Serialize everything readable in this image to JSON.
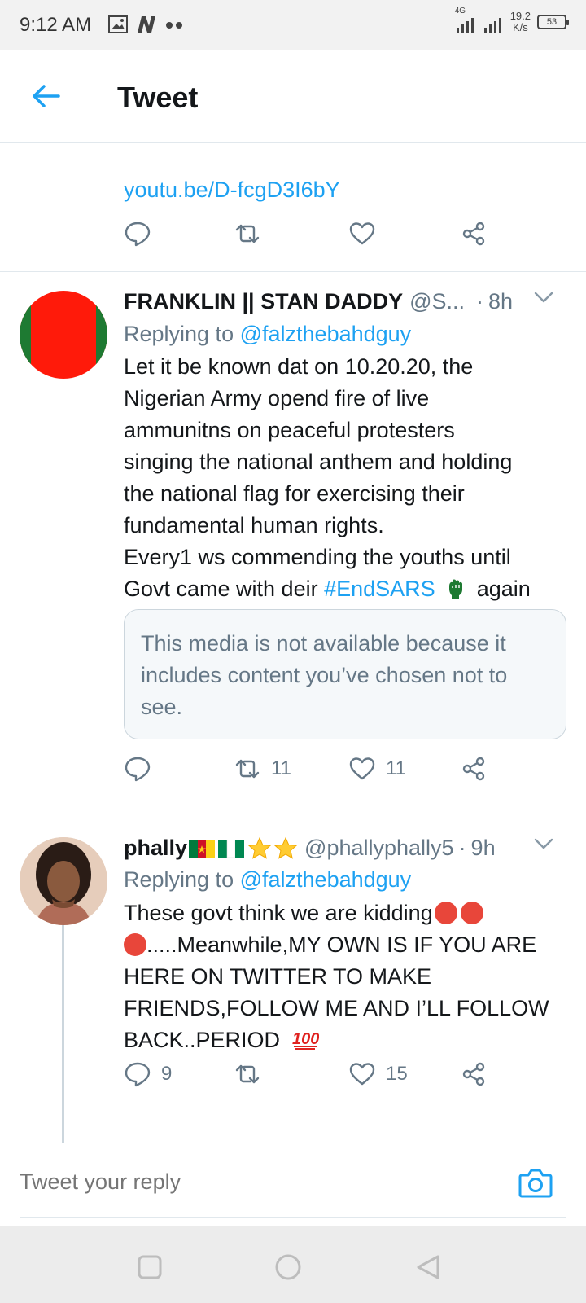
{
  "status_bar": {
    "time": "9:12 AM",
    "network_type": "4G",
    "net_speed_value": "19.2",
    "net_speed_unit": "K/s",
    "battery": "53"
  },
  "header": {
    "title": "Tweet"
  },
  "fragment": {
    "link": "youtu.be/D-fcgD3I6bY"
  },
  "tweets": [
    {
      "name": "FRANKLIN || STAN DADDY",
      "handle": "@S...",
      "time": "8h",
      "replying_prefix": "Replying to",
      "replying_handle": "@falzthebahdguy",
      "body_lines": [
        "Let it be known dat on 10.20.20, the",
        "Nigerian Army opend fire of live",
        "ammunitns on peaceful protesters",
        "singing the national anthem and holding",
        "the national flag for exercising their",
        "fundamental human rights."
      ],
      "body_line7": "Every1 ws commending the youths until",
      "body_line8_pre": "Govt came with deir",
      "hashtag": "#EndSARS",
      "body_line8_post": "again",
      "media_notice": "This media is not available because it includes content you’ve chosen not to see.",
      "retweets": "11",
      "likes": "11",
      "avatar_colors": {
        "fill": "#ff1a0a",
        "side": "#1e7a32"
      }
    },
    {
      "name": "phally",
      "handle": "@phallyphally5",
      "time": "9h",
      "replying_prefix": "Replying to",
      "replying_handle": "@falzthebahdguy",
      "body_line1": "These govt think we are kidding",
      "body_line2": ".....Meanwhile,MY OWN IS IF YOU ARE",
      "body_line3": "HERE ON TWITTER TO MAKE",
      "body_line4": "FRIENDS,FOLLOW ME AND I’LL FOLLOW",
      "body_line5": "BACK..PERIOD",
      "replies": "9",
      "likes": "15"
    }
  ],
  "reply_bar": {
    "placeholder": "Tweet your reply"
  },
  "colors": {
    "accent": "#1da1f2",
    "muted": "#657786",
    "text": "#14171a",
    "border": "#e1e8ed"
  },
  "icons": {
    "back": "arrow-left-icon",
    "reply": "speech-bubble-icon",
    "retweet": "retweet-icon",
    "like": "heart-icon",
    "share": "share-icon",
    "camera": "camera-icon",
    "chevron": "chevron-down-icon",
    "nav_recents": "square-icon",
    "nav_home": "circle-icon",
    "nav_back": "triangle-back-icon"
  }
}
